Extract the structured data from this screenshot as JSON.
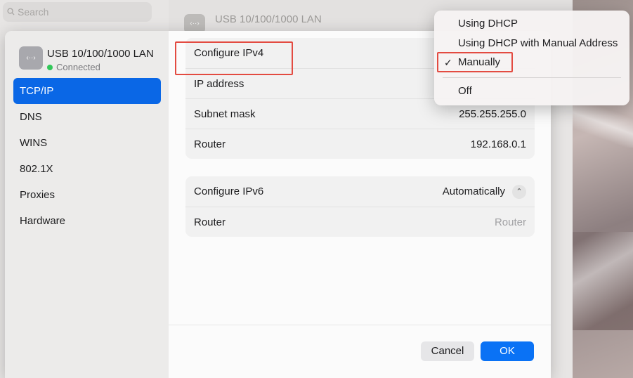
{
  "background": {
    "search_placeholder": "Search",
    "header_title": "USB 10/100/1000 LAN"
  },
  "sidebar": {
    "network_name": "USB 10/100/1000 LAN",
    "network_status": "Connected",
    "items": [
      {
        "label": "TCP/IP",
        "active": true
      },
      {
        "label": "DNS"
      },
      {
        "label": "WINS"
      },
      {
        "label": "802.1X"
      },
      {
        "label": "Proxies"
      },
      {
        "label": "Hardware"
      }
    ]
  },
  "ipv4": {
    "configure_label": "Configure IPv4",
    "ip_label": "IP address",
    "subnet_label": "Subnet mask",
    "subnet_value": "255.255.255.0",
    "router_label": "Router",
    "router_value": "192.168.0.1"
  },
  "ipv6": {
    "configure_label": "Configure IPv6",
    "configure_value": "Automatically",
    "router_label": "Router",
    "router_placeholder": "Router"
  },
  "buttons": {
    "cancel": "Cancel",
    "ok": "OK"
  },
  "menu": {
    "items": [
      {
        "label": "Using DHCP"
      },
      {
        "label": "Using DHCP with Manual Address"
      },
      {
        "label": "Manually",
        "checked": true
      },
      {
        "label": "Off"
      }
    ],
    "check_glyph": "✓"
  },
  "colors": {
    "accent": "#0a67e6",
    "status_connected": "#32c759",
    "annotation_box": "#e34b41"
  }
}
